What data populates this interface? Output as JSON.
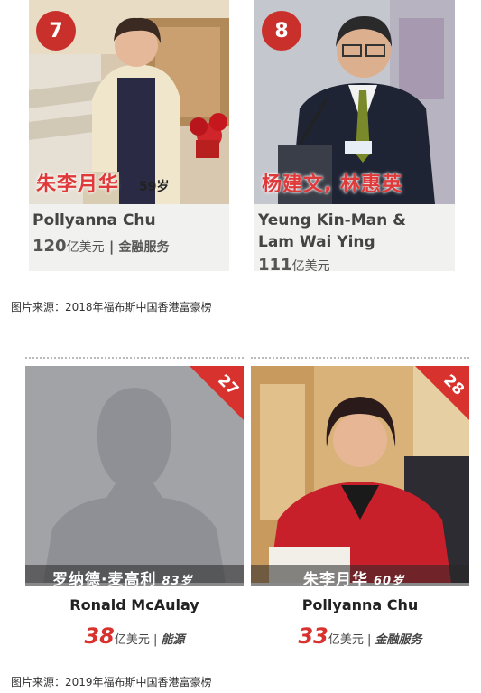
{
  "ranking_2018": {
    "people": [
      {
        "rank": "7",
        "chinese_name": "朱李月华",
        "age": "59岁",
        "english_name": "Pollyanna Chu",
        "worth_value": "120",
        "worth_unit": "亿美元",
        "separator": "|",
        "industry": "金融服务"
      },
      {
        "rank": "8",
        "chinese_name": "杨建文, 林惠英",
        "age": "",
        "english_name": "Yeung Kin-Man &",
        "english_name_line2": "Lam Wai Ying",
        "worth_value": "111",
        "worth_unit": "亿美元",
        "separator": "",
        "industry": ""
      }
    ],
    "caption": "图片来源：2018年福布斯中国香港富豪榜"
  },
  "ranking_2019": {
    "people": [
      {
        "rank": "27",
        "chinese_name": "罗纳德·麦高利",
        "age": "83岁",
        "english_name": "Ronald McAulay",
        "worth_value": "38",
        "worth_unit": "亿美元",
        "separator": "|",
        "industry": "能源"
      },
      {
        "rank": "28",
        "chinese_name": "朱李月华",
        "age": "60岁",
        "english_name": "Pollyanna Chu",
        "worth_value": "33",
        "worth_unit": "亿美元",
        "separator": "|",
        "industry": "金融服务"
      }
    ],
    "caption": "图片来源：2019年福布斯中国香港富豪榜"
  },
  "colors": {
    "accent_red": "#d7322d",
    "badge_red": "#c9302c",
    "card_bg": "#f1f1ef"
  }
}
